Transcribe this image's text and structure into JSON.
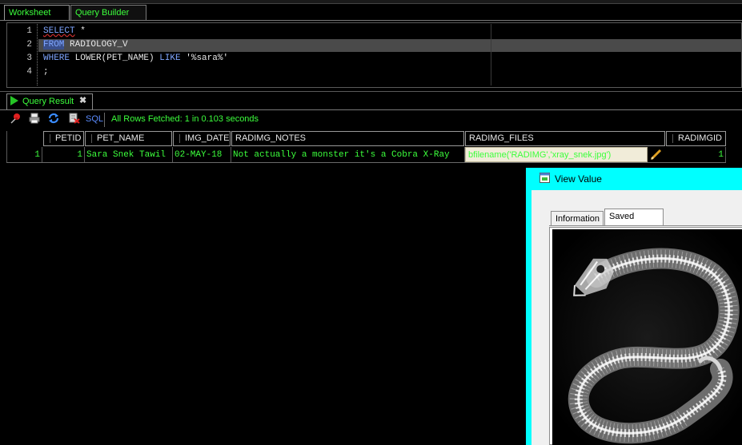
{
  "worksheet_tabs": [
    {
      "label": "Worksheet"
    },
    {
      "label": "Query Builder"
    }
  ],
  "editor": {
    "line_numbers": [
      "1",
      "2",
      "3",
      "4"
    ],
    "lines": [
      {
        "t1": "SELECT",
        "t2": " *"
      },
      {
        "t1": "FROM",
        "t2": " RADIOLOGY_V"
      },
      {
        "t1": "WHERE",
        "t2": " LOWER(PET_NAME) ",
        "t3": "LIKE",
        "t4": " '%sara%'"
      },
      {
        "t1": ";"
      }
    ]
  },
  "result_panel": {
    "tab_label": "Query Result",
    "close_glyph": "✖",
    "toolbar": {
      "sql_label": "SQL",
      "status": "All Rows Fetched: 1 in 0.103 seconds",
      "icons": [
        "pin-icon",
        "print-icon",
        "refresh-icon",
        "delete-icon"
      ]
    }
  },
  "grid": {
    "columns": [
      "PETID",
      "PET_NAME",
      "IMG_DATE",
      "RADIMG_NOTES",
      "RADIMG_FILES",
      "RADIMGID"
    ],
    "rows": [
      {
        "rownum": "1",
        "PETID": "1",
        "PET_NAME": "Sara Snek Tawil",
        "IMG_DATE": "02-MAY-18",
        "RADIMG_NOTES": "Not actually a monster it's a Cobra X-Ray",
        "RADIMG_FILES": "bfilename('RADIMG','xray_snek.jpg')",
        "RADIMGID": "1"
      }
    ]
  },
  "dialog": {
    "title": "View Value",
    "tabs": [
      "Information",
      "Saved Image"
    ],
    "active_tab": "Saved Image",
    "image_subject": "snake x-ray"
  },
  "colors": {
    "result_text": "#3cff3c",
    "keyword": "#7fa6ff",
    "dialog_frame": "#00ffff",
    "line_highlight": "#4a4a4a"
  }
}
